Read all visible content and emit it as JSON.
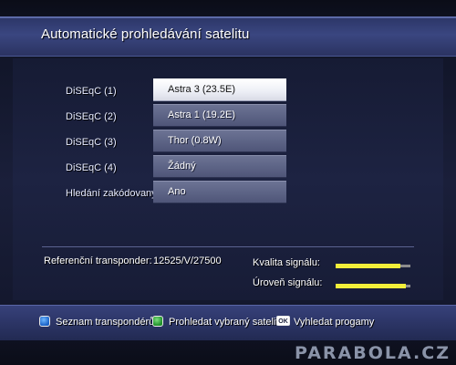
{
  "header": {
    "title": "Automatické prohledávání satelitu"
  },
  "settings": [
    {
      "label": "DiSEqC (1)",
      "value": "Astra 3 (23.5E)",
      "selected": true
    },
    {
      "label": "DiSEqC (2)",
      "value": "Astra 1 (19.2E)",
      "selected": false
    },
    {
      "label": "DiSEqC (3)",
      "value": "Thor (0.8W)",
      "selected": false
    },
    {
      "label": "DiSEqC (4)",
      "value": "Žádný",
      "selected": false
    },
    {
      "label": "Hledání zakódovaný...",
      "value": "Ano",
      "selected": false
    }
  ],
  "info": {
    "transponder_label": "Referenční transponder:",
    "transponder_value": "12525/V/27500",
    "quality_label": "Kvalita signálu:",
    "quality_level": 0.86,
    "level_label": "Úroveň signálu:",
    "level_level": 0.94
  },
  "footer": {
    "hints": [
      {
        "key": "blue",
        "label": "Seznam transpondérů"
      },
      {
        "key": "green",
        "label": "Prohledat vybraný satelit"
      },
      {
        "key": "OK",
        "label": "Vyhledat progamy"
      }
    ]
  },
  "watermark": "PARABOLA.CZ",
  "colors": {
    "accent_yellow": "#f2ef3a",
    "selected_field": "#ffffff",
    "field": "#5c6385"
  }
}
